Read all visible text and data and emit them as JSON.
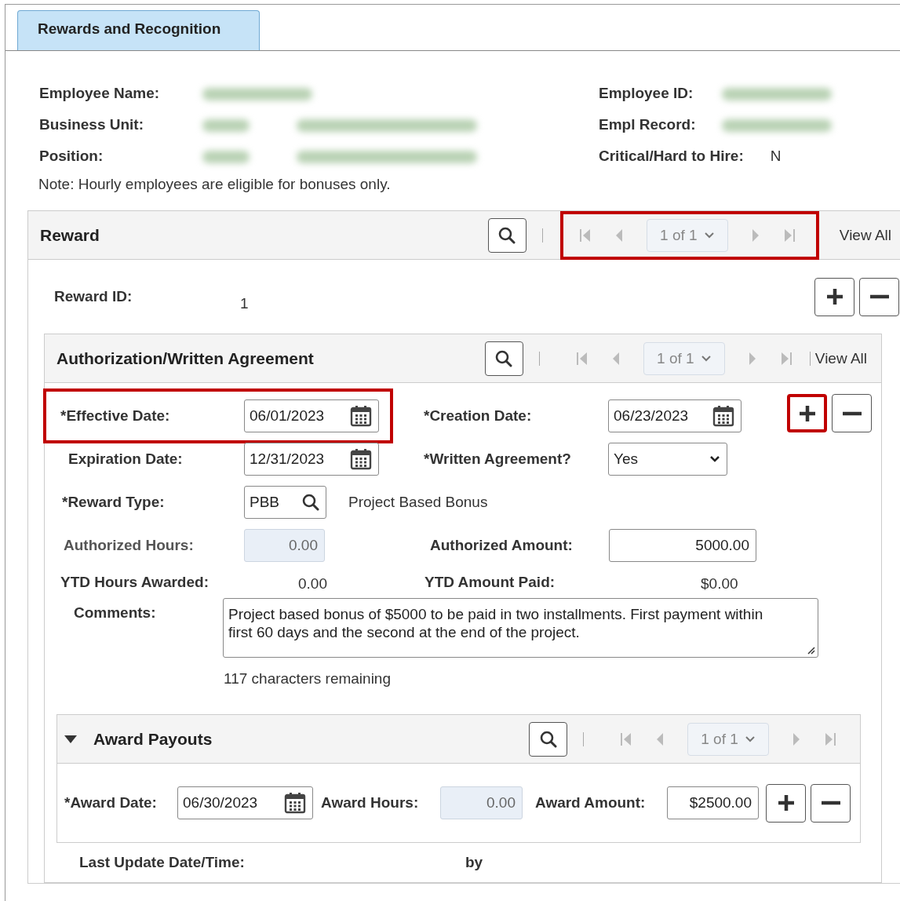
{
  "tabs": [
    {
      "label": "Rewards and Recognition",
      "selected": true
    }
  ],
  "employee": {
    "left": [
      {
        "label": "Employee Name:",
        "kind": "redacted"
      },
      {
        "label": "Business Unit:",
        "kind": "redacted_pair"
      },
      {
        "label": "Position:",
        "kind": "redacted_pair"
      }
    ],
    "right": [
      {
        "label": "Employee ID:",
        "kind": "redacted"
      },
      {
        "label": "Empl Record:",
        "kind": "redacted"
      },
      {
        "label": "Critical/Hard to Hire:",
        "kind": "text",
        "value": "N"
      }
    ]
  },
  "note": "Note: Hourly employees are eligible for bonuses only.",
  "reward": {
    "title": "Reward",
    "pager": {
      "text": "1 of 1",
      "highlighted": true
    },
    "view_all": "View All",
    "id_label": "Reward ID:",
    "id_value": "1",
    "add_highlighted": false
  },
  "authorization": {
    "title": "Authorization/Written Agreement",
    "pager": {
      "text": "1 of 1",
      "highlighted": false
    },
    "view_all": "View All",
    "add_highlighted": true,
    "effective_date": {
      "label": "*Effective Date:",
      "value": "06/01/2023",
      "highlighted": true
    },
    "creation_date": {
      "label": "*Creation Date:",
      "value": "06/23/2023"
    },
    "expiration_date": {
      "label": "Expiration Date:",
      "value": "12/31/2023"
    },
    "written_agreement": {
      "label": "*Written Agreement?",
      "value": "Yes"
    },
    "reward_type": {
      "label": "*Reward Type:",
      "value": "PBB",
      "description": "Project Based Bonus"
    },
    "authorized_hours": {
      "label": "Authorized Hours:",
      "value": "0.00",
      "disabled": true
    },
    "authorized_amount": {
      "label": "Authorized Amount:",
      "value": "5000.00",
      "disabled": false
    },
    "ytd_hours": {
      "label": "YTD Hours Awarded:",
      "value": "0.00"
    },
    "ytd_amount": {
      "label": "YTD Amount Paid:",
      "value": "$0.00"
    },
    "comments": {
      "label": "Comments:",
      "value": "Project based bonus of $5000 to be paid in two installments. First payment within first 60 days and the second at the end of the project."
    },
    "remaining": "117 characters remaining",
    "award_payouts": {
      "title": "Award Payouts",
      "expanded": true,
      "pager": {
        "text": "1 of 1",
        "highlighted": false
      },
      "award_date": {
        "label": "*Award Date:",
        "value": "06/30/2023"
      },
      "award_hours": {
        "label": "Award Hours:",
        "value": "0.00",
        "disabled": true
      },
      "award_amount": {
        "label": "Award Amount:",
        "value": "$2500.00",
        "disabled": false
      }
    },
    "last_update": {
      "label": "Last Update Date/Time:",
      "by": "by"
    }
  }
}
